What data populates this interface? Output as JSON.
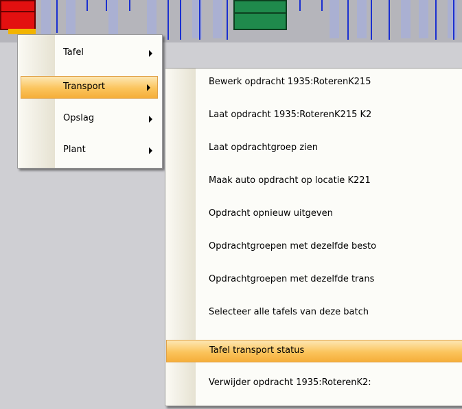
{
  "context_menu": {
    "items": [
      {
        "label": "Tafel",
        "has_submenu": true,
        "highlighted": false
      },
      {
        "label": "Transport",
        "has_submenu": true,
        "highlighted": true
      },
      {
        "label": "Opslag",
        "has_submenu": true,
        "highlighted": false
      },
      {
        "label": "Plant",
        "has_submenu": true,
        "highlighted": false
      }
    ]
  },
  "transport_submenu": {
    "items": [
      {
        "label": "Bewerk opdracht 1935:RoterenK215"
      },
      {
        "label": "Laat opdracht 1935:RoterenK215 K2"
      },
      {
        "label": "Laat opdrachtgroep zien"
      },
      {
        "label": "Maak auto opdracht op locatie K221"
      },
      {
        "label": "Opdracht opnieuw uitgeven"
      },
      {
        "label": "Opdrachtgroepen met dezelfde besto"
      },
      {
        "label": "Opdrachtgroepen met dezelfde trans"
      },
      {
        "label": "Selecteer alle tafels van deze batch"
      },
      {
        "label": "Tafel transport status",
        "highlighted": true
      },
      {
        "label": "Verwijder opdracht 1935:RoterenK2:"
      }
    ]
  },
  "colors": {
    "highlight": "#fbc45c",
    "menu_background": "#fcfcf8",
    "canvas_background": "#cfcfd3",
    "red_block": "#e31010",
    "green_block": "#1f8a4c",
    "line_blue": "#1a2fd0"
  }
}
